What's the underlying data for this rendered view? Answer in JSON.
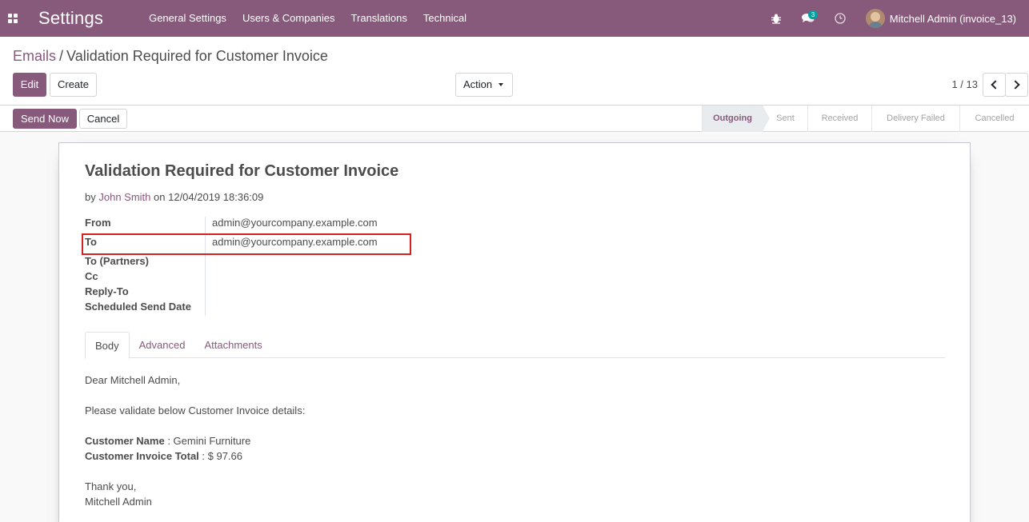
{
  "navbar": {
    "app_title": "Settings",
    "menu": [
      "General Settings",
      "Users & Companies",
      "Translations",
      "Technical"
    ],
    "messages_count": "3",
    "user_name": "Mitchell Admin (invoice_13)",
    "icons": [
      "apps-grid-icon",
      "bug-icon",
      "chat-icon",
      "clock-icon"
    ]
  },
  "breadcrumb": {
    "parent": "Emails",
    "separator": "/",
    "current": "Validation Required for Customer Invoice"
  },
  "toolbar": {
    "edit_label": "Edit",
    "create_label": "Create",
    "action_label": "Action",
    "pager": "1 / 13"
  },
  "statusbar": {
    "send_now_label": "Send Now",
    "cancel_label": "Cancel",
    "stages": [
      "Outgoing",
      "Sent",
      "Received",
      "Delivery Failed",
      "Cancelled"
    ],
    "active_stage": "Outgoing"
  },
  "form": {
    "subject": "Validation Required for Customer Invoice",
    "by_prefix": "by",
    "author": "John Smith",
    "date_text": "on 12/04/2019 18:36:09",
    "fields": {
      "from_label": "From",
      "from_value": "admin@yourcompany.example.com",
      "to_label": "To",
      "to_value": "admin@yourcompany.example.com",
      "to_partners_label": "To (Partners)",
      "cc_label": "Cc",
      "reply_to_label": "Reply-To",
      "scheduled_label": "Scheduled Send Date"
    },
    "tabs": [
      "Body",
      "Advanced",
      "Attachments"
    ],
    "active_tab": "Body",
    "body": {
      "greeting": "Dear Mitchell Admin,",
      "intro": "Please validate below Customer Invoice details:",
      "customer_name_label": "Customer Name",
      "customer_name_value": " : Gemini Furniture",
      "invoice_total_label": "Customer Invoice Total",
      "invoice_total_value": " : $ 97.66",
      "closing": "Thank you,",
      "signature": "Mitchell Admin"
    }
  },
  "colors": {
    "brand": "#875a7b",
    "highlight_border": "#d62020",
    "badge": "#00a09d"
  }
}
